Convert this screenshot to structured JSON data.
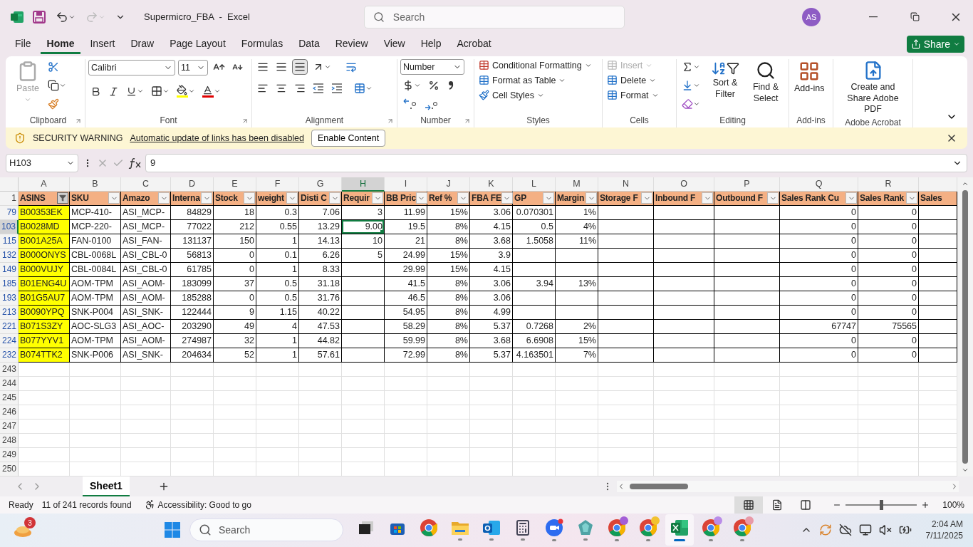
{
  "title_bar": {
    "file_title": "Supermicro_FBA  -  Excel",
    "search_placeholder": "Search",
    "avatar": "AS",
    "redo_disabled": true
  },
  "menu": {
    "tabs": [
      {
        "label": "File",
        "selected": false
      },
      {
        "label": "Home",
        "selected": true
      },
      {
        "label": "Insert",
        "selected": false
      },
      {
        "label": "Draw",
        "selected": false
      },
      {
        "label": "Page Layout",
        "selected": false
      },
      {
        "label": "Formulas",
        "selected": false
      },
      {
        "label": "Data",
        "selected": false
      },
      {
        "label": "Review",
        "selected": false
      },
      {
        "label": "View",
        "selected": false
      },
      {
        "label": "Help",
        "selected": false
      },
      {
        "label": "Acrobat",
        "selected": false
      }
    ],
    "share": "Share"
  },
  "ribbon": {
    "clipboard": {
      "label": "Clipboard",
      "paste": {
        "label": "Paste",
        "disabled": true
      }
    },
    "font": {
      "label": "Font",
      "font_name": "Calibri",
      "font_size": "11"
    },
    "alignment": {
      "label": "Alignment"
    },
    "number": {
      "label": "Number",
      "format": "Number"
    },
    "styles": {
      "label": "Styles",
      "buttons": [
        "Conditional Formatting",
        "Format as Table",
        "Cell Styles"
      ]
    },
    "cells": {
      "label": "Cells",
      "buttons": [
        {
          "label": "Insert",
          "disabled": true
        },
        {
          "label": "Delete",
          "disabled": false
        },
        {
          "label": "Format",
          "disabled": false
        }
      ]
    },
    "editing": {
      "label": "Editing",
      "buttons": [
        "Sort & Filter",
        "Find & Select"
      ]
    },
    "addins": {
      "label": "Add-ins",
      "button": "Add-ins"
    },
    "acrobat": {
      "label": "Adobe Acrobat",
      "button": "Create and Share Adobe PDF"
    }
  },
  "security_bar": {
    "title": "SECURITY WARNING",
    "message": "Automatic update of links has been disabled",
    "button": "Enable Content"
  },
  "formula_bar": {
    "name_box": "H103",
    "formula": "9"
  },
  "sheet": {
    "columns": [
      {
        "letter": "A",
        "header": "ASINS",
        "filter_button": true,
        "filtered": true,
        "highlighted": true,
        "selected": false
      },
      {
        "letter": "B",
        "header": "SKU",
        "filter_button": true,
        "filtered": false,
        "highlighted": false,
        "selected": false
      },
      {
        "letter": "C",
        "header": "Amazo",
        "filter_button": true,
        "filtered": false,
        "highlighted": false,
        "selected": false
      },
      {
        "letter": "D",
        "header": "Interna",
        "filter_button": true,
        "filtered": false,
        "highlighted": false,
        "selected": false
      },
      {
        "letter": "E",
        "header": "Stock",
        "filter_button": true,
        "filtered": false,
        "highlighted": false,
        "selected": false
      },
      {
        "letter": "F",
        "header": "weight",
        "filter_button": true,
        "filtered": false,
        "highlighted": false,
        "selected": false
      },
      {
        "letter": "G",
        "header": "Disti C",
        "filter_button": true,
        "filtered": false,
        "highlighted": false,
        "selected": false
      },
      {
        "letter": "H",
        "header": "Requir",
        "filter_button": true,
        "filtered": false,
        "highlighted": false,
        "selected": true
      },
      {
        "letter": "I",
        "header": "BB Pric",
        "filter_button": true,
        "filtered": false,
        "highlighted": false,
        "selected": false
      },
      {
        "letter": "J",
        "header": "Ref %",
        "filter_button": true,
        "filtered": false,
        "highlighted": false,
        "selected": false
      },
      {
        "letter": "K",
        "header": "FBA FE",
        "filter_button": true,
        "filtered": false,
        "highlighted": false,
        "selected": false
      },
      {
        "letter": "L",
        "header": "GP",
        "filter_button": true,
        "filtered": false,
        "highlighted": false,
        "selected": false
      },
      {
        "letter": "M",
        "header": "Margin",
        "filter_button": true,
        "filtered": false,
        "highlighted": false,
        "selected": false
      },
      {
        "letter": "N",
        "header": "Storage F",
        "filter_button": true,
        "filtered": false,
        "highlighted": false,
        "selected": false
      },
      {
        "letter": "O",
        "header": "Inbound F",
        "filter_button": true,
        "filtered": false,
        "highlighted": false,
        "selected": false
      },
      {
        "letter": "P",
        "header": "Outbound F",
        "filter_button": true,
        "filtered": false,
        "highlighted": false,
        "selected": false
      },
      {
        "letter": "Q",
        "header": "Sales Rank Cu",
        "filter_button": true,
        "filtered": false,
        "highlighted": false,
        "selected": false
      },
      {
        "letter": "R",
        "header": "Sales Rank",
        "filter_button": true,
        "filtered": false,
        "highlighted": false,
        "selected": false
      },
      {
        "header": "Sales",
        "filter_button": false,
        "highlighted": false,
        "selected": false
      }
    ],
    "header_row": "1",
    "rows": [
      {
        "number": "79",
        "selected": false,
        "cells": [
          "B00353EK",
          "MCP-410-",
          "ASI_MCP-",
          "84829",
          "18",
          "0.3",
          "7.06",
          "3",
          "11.99",
          "15%",
          "3.06",
          "0.070301",
          "1%",
          null,
          null,
          null,
          "0",
          "0",
          null
        ]
      },
      {
        "number": "103",
        "selected": true,
        "cells": [
          "B0028MD",
          "MCP-220-",
          "ASI_MCP-",
          "77022",
          "212",
          "0.55",
          "13.29",
          "9.00",
          "19.5",
          "8%",
          "4.15",
          "0.5",
          "4%",
          null,
          null,
          null,
          "0",
          "0",
          null
        ]
      },
      {
        "number": "115",
        "selected": false,
        "cells": [
          "B001A25A",
          "FAN-0100",
          "ASI_FAN-",
          "131137",
          "150",
          "1",
          "14.13",
          "10",
          "21",
          "8%",
          "3.68",
          "1.5058",
          "11%",
          null,
          null,
          null,
          "0",
          "0",
          null
        ]
      },
      {
        "number": "132",
        "selected": false,
        "cells": [
          "B000ONYS",
          "CBL-0068L",
          "ASI_CBL-0",
          "56813",
          "0",
          "0.1",
          "6.26",
          "5",
          "24.99",
          "15%",
          "3.9",
          null,
          null,
          null,
          null,
          null,
          "0",
          "0",
          null
        ]
      },
      {
        "number": "149",
        "selected": false,
        "cells": [
          "B000VUJY",
          "CBL-0084L",
          "ASI_CBL-0",
          "61785",
          "0",
          "1",
          "8.33",
          null,
          "29.99",
          "15%",
          "4.15",
          null,
          null,
          null,
          null,
          null,
          "0",
          "0",
          null
        ]
      },
      {
        "number": "185",
        "selected": false,
        "cells": [
          "B01ENG4U",
          "AOM-TPM",
          "ASI_AOM-",
          "183099",
          "37",
          "0.5",
          "31.18",
          null,
          "41.5",
          "8%",
          "3.06",
          "3.94",
          "13%",
          null,
          null,
          null,
          "0",
          "0",
          null
        ]
      },
      {
        "number": "193",
        "selected": false,
        "cells": [
          "B01G5AU7",
          "AOM-TPM",
          "ASI_AOM-",
          "185288",
          "0",
          "0.5",
          "31.76",
          null,
          "46.5",
          "8%",
          "3.06",
          null,
          null,
          null,
          null,
          null,
          "0",
          "0",
          null
        ]
      },
      {
        "number": "213",
        "selected": false,
        "cells": [
          "B0090YPQ",
          "SNK-P004",
          "ASI_SNK-",
          "122444",
          "9",
          "1.15",
          "40.22",
          null,
          "54.95",
          "8%",
          "4.99",
          null,
          null,
          null,
          null,
          null,
          "0",
          "0",
          null
        ]
      },
      {
        "number": "221",
        "selected": false,
        "cells": [
          "B071S3ZY",
          "AOC-SLG3",
          "ASI_AOC-",
          "203290",
          "49",
          "4",
          "47.53",
          null,
          "58.29",
          "8%",
          "5.37",
          "0.7268",
          "2%",
          null,
          null,
          null,
          "67747",
          "75565",
          null
        ]
      },
      {
        "number": "224",
        "selected": false,
        "cells": [
          "B077YYV1",
          "AOM-TPM",
          "ASI_AOM-",
          "274987",
          "32",
          "1",
          "44.82",
          null,
          "59.99",
          "8%",
          "3.68",
          "6.6908",
          "15%",
          null,
          null,
          null,
          "0",
          "0",
          null
        ]
      },
      {
        "number": "232",
        "selected": false,
        "cells": [
          "B074TTK2",
          "SNK-P006",
          "ASI_SNK-",
          "204634",
          "52",
          "1",
          "57.61",
          null,
          "72.99",
          "8%",
          "5.37",
          "4.163501",
          "7%",
          null,
          null,
          null,
          "0",
          "0",
          null
        ]
      }
    ],
    "empty_rows": [
      "243",
      "244",
      "245",
      "246",
      "247",
      "248",
      "249",
      "250"
    ]
  },
  "sheet_tabs": [
    {
      "label": "Sheet1",
      "selected": true
    }
  ],
  "status_bar": {
    "mode": "Ready",
    "records": "11 of 241 records found",
    "accessibility": "Accessibility: Good to go",
    "views": [
      {
        "kind": "normal",
        "selected": true
      },
      {
        "kind": "page-layout",
        "selected": false
      },
      {
        "kind": "page-break",
        "selected": false
      }
    ],
    "zoom_slider": {
      "level": 0.5
    },
    "zoom": "100%"
  },
  "taskbar": {
    "widget_badge": "3",
    "search_placeholder": "Search",
    "apps": [
      {
        "kind": "task-view",
        "running": false,
        "selected": false
      },
      {
        "kind": "store",
        "running": false,
        "selected": false
      },
      {
        "kind": "browser",
        "running": false,
        "selected": false
      },
      {
        "kind": "folder",
        "running": true,
        "selected": false
      },
      {
        "kind": "mail",
        "running": true,
        "selected": false
      },
      {
        "kind": "calculator",
        "running": true,
        "selected": false
      },
      {
        "kind": "meeting",
        "running": true,
        "selected": false
      },
      {
        "kind": "gem",
        "running": true,
        "selected": false
      },
      {
        "kind": "browser",
        "running": true,
        "selected": false,
        "color": "#a45ed6"
      },
      {
        "kind": "browser",
        "running": true,
        "selected": false,
        "color": "#f2c230"
      },
      {
        "kind": "spreadsheet",
        "running": true,
        "selected": true
      },
      {
        "kind": "browser",
        "running": true,
        "selected": false,
        "color": "#b98ce8"
      },
      {
        "kind": "browser",
        "running": true,
        "selected": false,
        "color": "#e89aa8"
      }
    ],
    "time": "2:04 AM",
    "date": "7/11/2025"
  }
}
